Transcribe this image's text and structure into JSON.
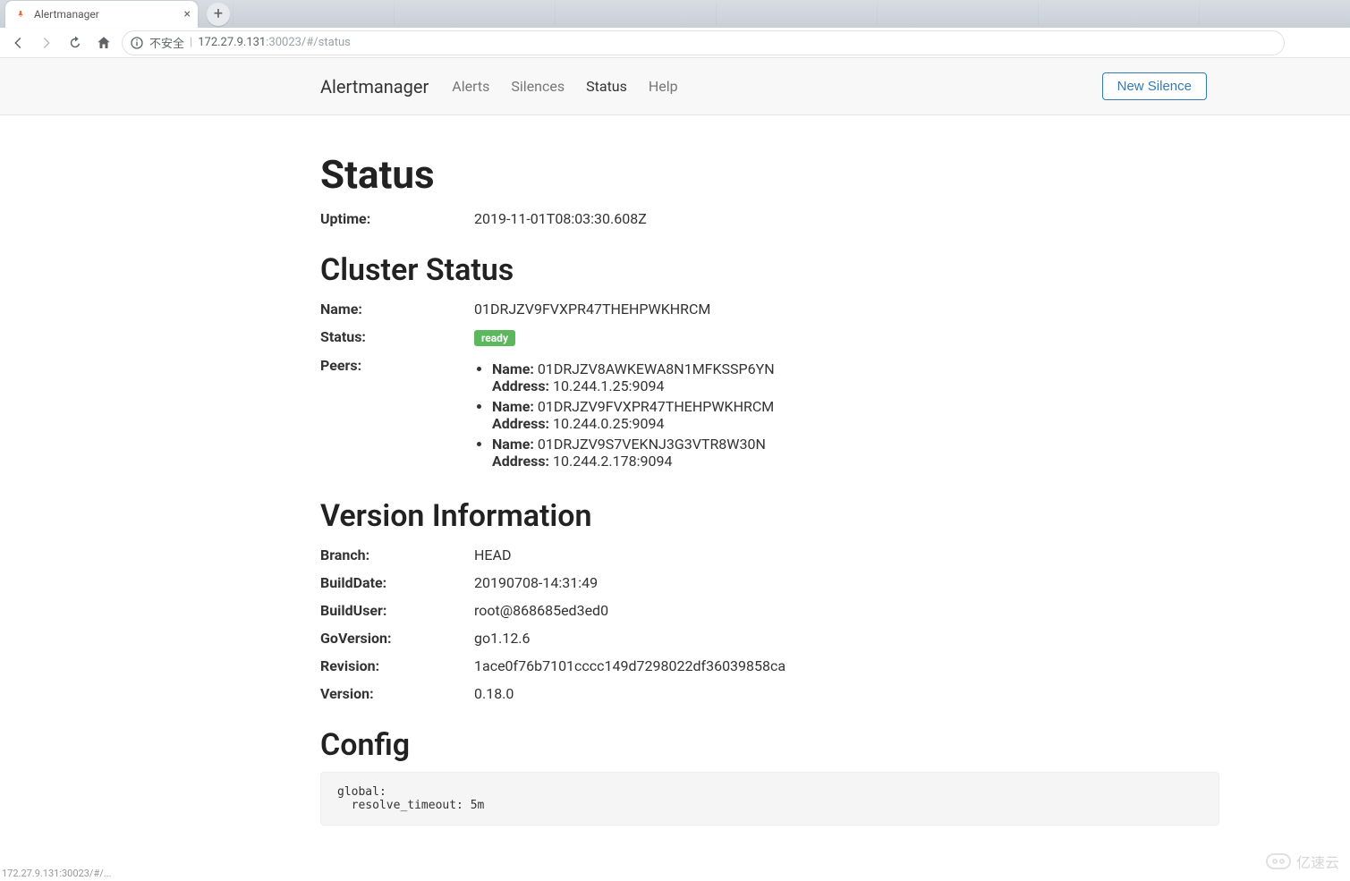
{
  "browser": {
    "tab_title": "Alertmanager",
    "insecure_label": "不安全",
    "url_display": {
      "host": "172.27.9.131",
      "path": ":30023/#/status"
    },
    "statusbar_hint": "172.27.9.131:30023/#/..."
  },
  "nav": {
    "brand": "Alertmanager",
    "links": [
      {
        "label": "Alerts",
        "active": false
      },
      {
        "label": "Silences",
        "active": false
      },
      {
        "label": "Status",
        "active": true
      },
      {
        "label": "Help",
        "active": false
      }
    ],
    "new_silence_label": "New Silence"
  },
  "page": {
    "title": "Status",
    "uptime_label": "Uptime:",
    "uptime_value": "2019-11-01T08:03:30.608Z",
    "cluster": {
      "heading": "Cluster Status",
      "name_label": "Name:",
      "name_value": "01DRJZV9FVXPR47THEHPWKHRCM",
      "status_label": "Status:",
      "status_badge": "ready",
      "peers_label": "Peers:",
      "peers_name_label": "Name:",
      "peers_address_label": "Address:",
      "peers": [
        {
          "name": "01DRJZV8AWKEWA8N1MFKSSP6YN",
          "address": "10.244.1.25:9094"
        },
        {
          "name": "01DRJZV9FVXPR47THEHPWKHRCM",
          "address": "10.244.0.25:9094"
        },
        {
          "name": "01DRJZV9S7VEKNJ3G3VTR8W30N",
          "address": "10.244.2.178:9094"
        }
      ]
    },
    "version": {
      "heading": "Version Information",
      "rows": [
        {
          "label": "Branch:",
          "value": "HEAD"
        },
        {
          "label": "BuildDate:",
          "value": "20190708-14:31:49"
        },
        {
          "label": "BuildUser:",
          "value": "root@868685ed3ed0"
        },
        {
          "label": "GoVersion:",
          "value": "go1.12.6"
        },
        {
          "label": "Revision:",
          "value": "1ace0f76b7101cccc149d7298022df36039858ca"
        },
        {
          "label": "Version:",
          "value": "0.18.0"
        }
      ]
    },
    "config": {
      "heading": "Config",
      "text": "global:\n  resolve_timeout: 5m"
    }
  },
  "watermark": "亿速云"
}
